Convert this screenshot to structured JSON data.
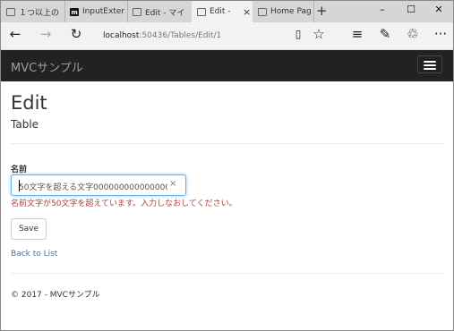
{
  "browser": {
    "tabs": [
      {
        "label": "１つ以上の",
        "icon": "page-icon"
      },
      {
        "label": "InputExter",
        "icon": "m-logo-icon",
        "icon_letter": "m"
      },
      {
        "label": "Edit - マイ",
        "icon": "page-icon"
      },
      {
        "label": "Edit -",
        "icon": "page-icon",
        "active": true
      },
      {
        "label": "Home Pag",
        "icon": "page-icon"
      }
    ],
    "close_glyph": "×",
    "new_tab_glyph": "+",
    "window_controls": {
      "minimize": "–",
      "maximize": "☐",
      "close": "✕"
    },
    "address": {
      "host": "localhost",
      "path": ":50436/Tables/Edit/1"
    },
    "toolbar_icons": [
      "back-arrow-icon",
      "forward-arrow-icon",
      "refresh-icon",
      "reading-view-icon",
      "favorite-star-icon",
      "hub-icon",
      "web-note-icon",
      "share-icon",
      "more-icon"
    ]
  },
  "navbar": {
    "brand": "MVCサンプル"
  },
  "page": {
    "title": "Edit",
    "subtitle": "Table",
    "field_label": "名前",
    "field_value": "50文字を超える文字000000000000000",
    "validation_error": "名前文字が50文字を超えています。入力しなおしてください。",
    "save_label": "Save",
    "back_link": "Back to List",
    "footer": "© 2017 - MVCサンプル"
  },
  "colors": {
    "navbar_bg": "#222222",
    "link": "#337ab7",
    "error": "#a94442",
    "focus_border": "#66afe9"
  }
}
